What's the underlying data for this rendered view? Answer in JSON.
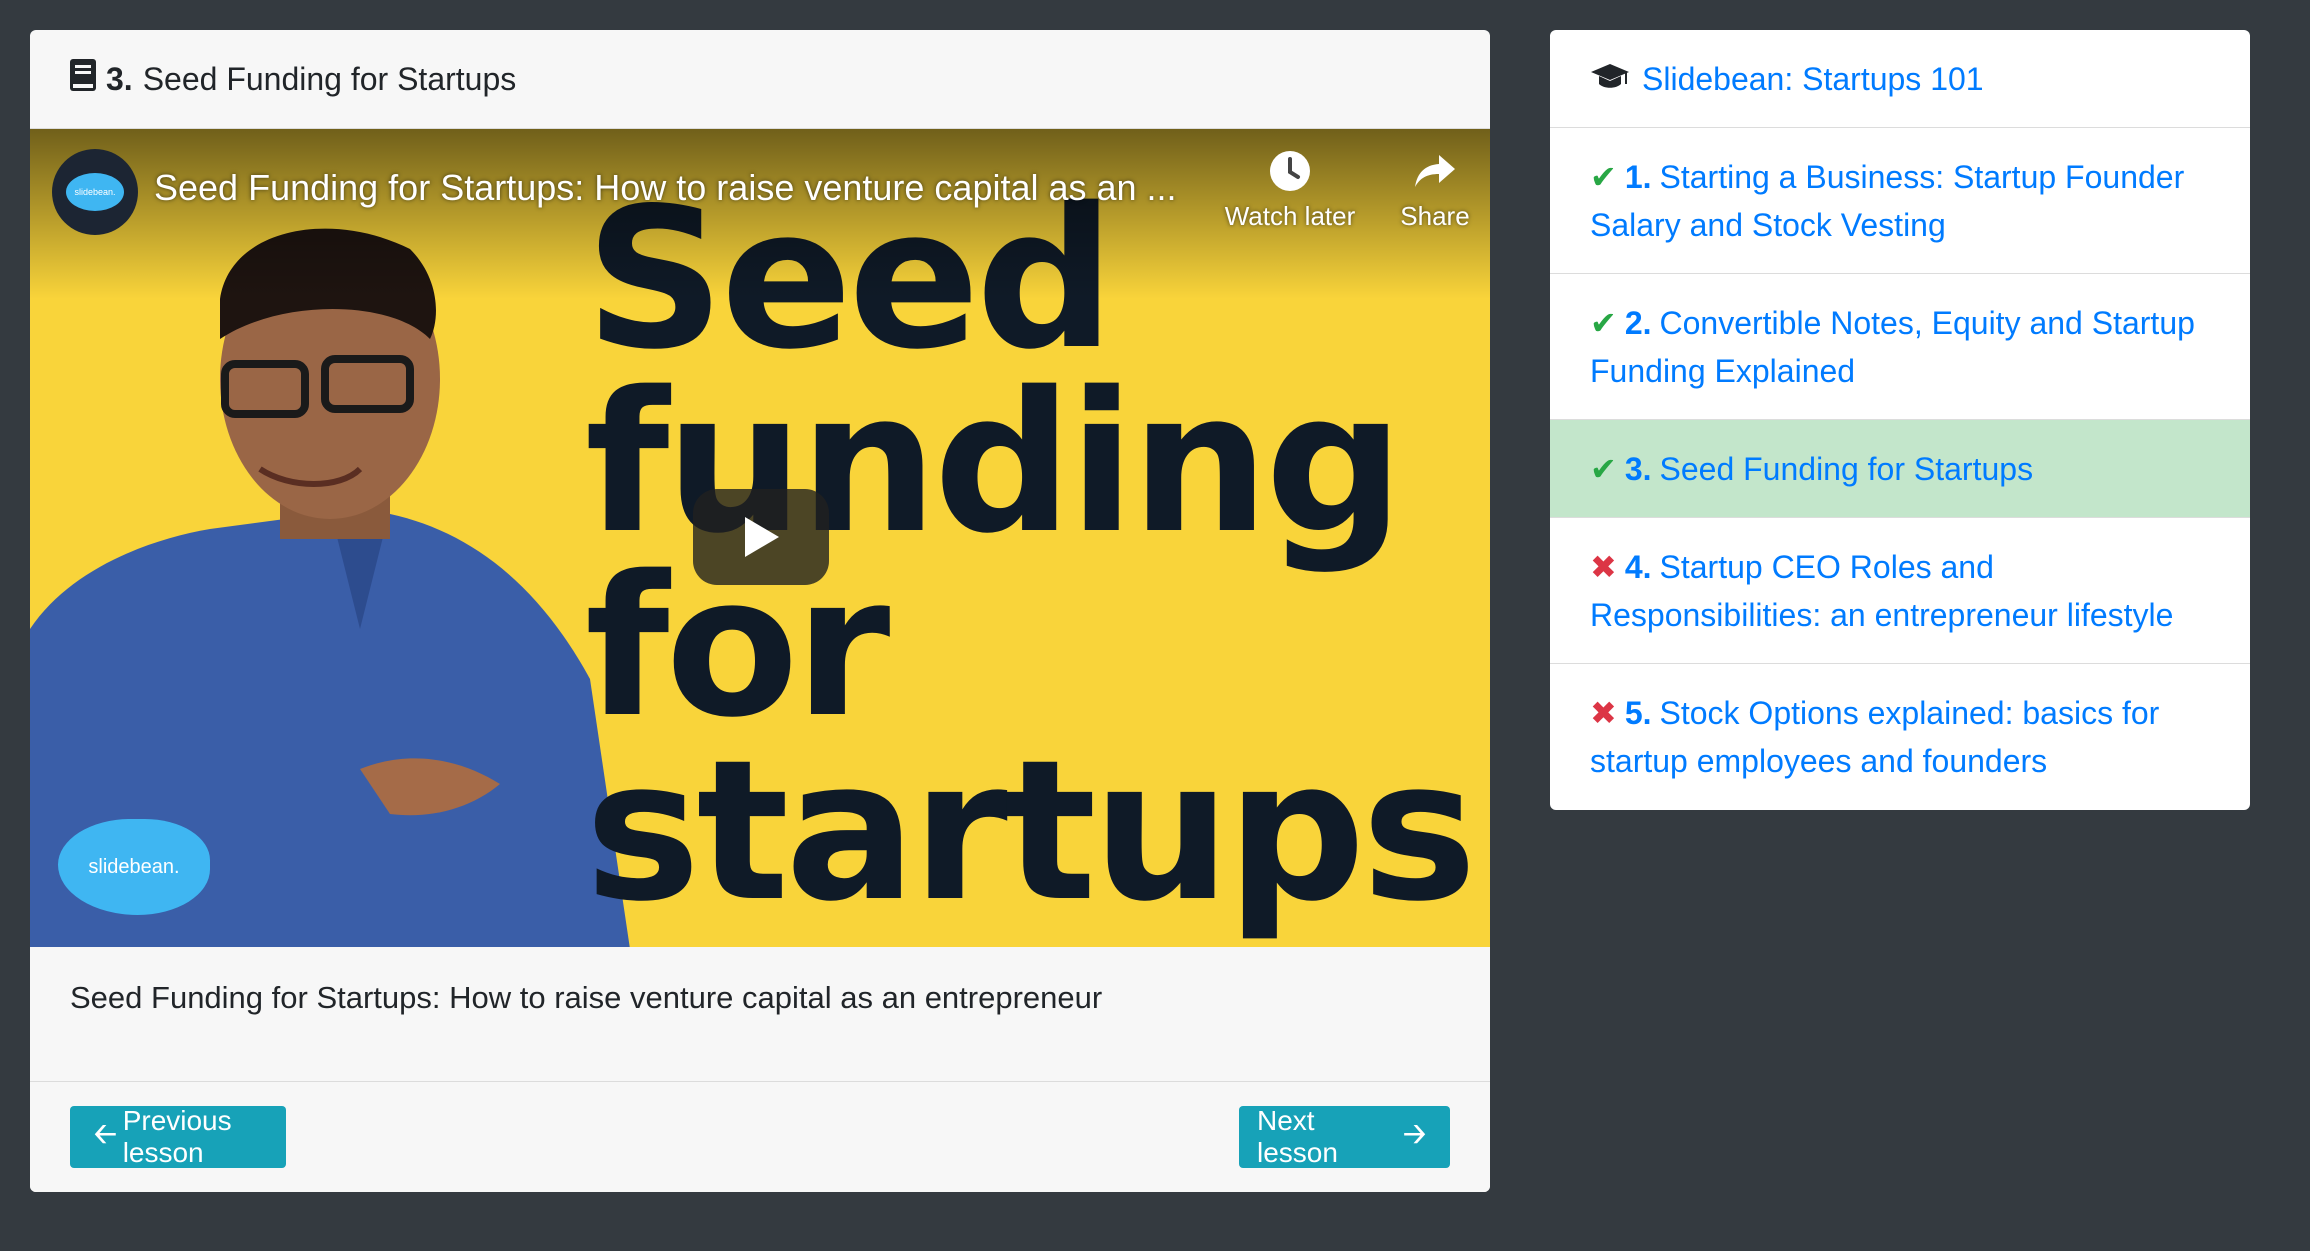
{
  "lesson": {
    "number": "3.",
    "title": "Seed Funding for Startups",
    "caption": "Seed Funding for Startups: How to raise venture capital as an entrepreneur"
  },
  "video": {
    "title": "Seed Funding for Startups: How to raise venture capital as an ...",
    "watch_later": "Watch later",
    "share": "Share",
    "thumbnail_lines": [
      "Seed",
      "funding",
      "for",
      "startups"
    ],
    "brand_badge": "slidebean.",
    "channel_logo_text": "slidebean."
  },
  "nav": {
    "previous": "Previous lesson",
    "next": "Next lesson"
  },
  "course": {
    "title": "Slidebean: Startups 101",
    "lessons": [
      {
        "status": "done",
        "number": "1.",
        "title": "Starting a Business: Startup Founder Salary and Stock Vesting"
      },
      {
        "status": "done",
        "number": "2.",
        "title": "Convertible Notes, Equity and Startup Funding Explained"
      },
      {
        "status": "done",
        "number": "3.",
        "title": "Seed Funding for Startups",
        "active": true
      },
      {
        "status": "todo",
        "number": "4.",
        "title": "Startup CEO Roles and Responsibilities: an entrepreneur lifestyle"
      },
      {
        "status": "todo",
        "number": "5.",
        "title": "Stock Options explained: basics for startup employees and founders"
      }
    ]
  },
  "colors": {
    "background": "#343a40",
    "link": "#007bff",
    "success": "#28a745",
    "danger": "#dc3545",
    "button": "#17a2b8",
    "active_row": "#c3e6cb",
    "thumbnail_bg": "#f9d43a"
  }
}
